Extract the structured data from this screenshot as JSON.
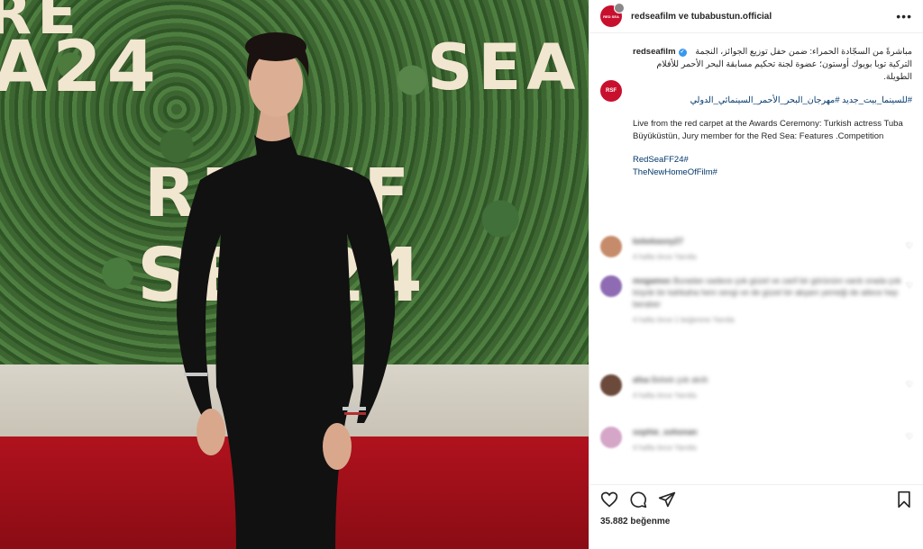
{
  "photo": {
    "backdrop_logo_top": "RE",
    "backdrop_logo_top2": "A24",
    "backdrop_logo_mid": "REDFF",
    "backdrop_logo_mid2": "SEA24",
    "backdrop_logo_right": "SEA"
  },
  "header": {
    "title": "redseafilm ve tubabustun.official",
    "avatar_text": "RED SEA"
  },
  "caption": {
    "username": "redseafilm",
    "arabic_text": "مباشرةً من السجّادة الحمراء: ضمن حفل توزيع الجوائز، النجمة التركية توبا بويوك أوستون؛ عضوة لجنة تحكيم مسابقة البحر الأحمر للأفلام الطويلة.",
    "arabic_tags": "#للسينما_بيت_جديد #مهرجان_البحر_الأحمر_السينمائي_الدولي",
    "english_text": "Live from the red carpet at the Awards Ceremony: Turkish actress Tuba Büyüküstün, Jury member for the Red Sea: Features .Competition",
    "tag1": "RedSeaFF24#",
    "tag2": "TheNewHomeOfFilm#"
  },
  "comments": [
    {
      "user": "kebekasoy27",
      "text": "",
      "meta": "4 hafta önce    Yanıtla",
      "avatar_color": "#c68b6a"
    },
    {
      "user": "mogamoc",
      "text": "Buradan sadece çok güzel ve zarif bir görünüm vardı orada çok büyük bir kahkaha hem sevgi ve de güzel bir akşam yemeği de ailece hep beraber",
      "meta": "4 hafta önce    1 beğenme    Yanıtla",
      "avatar_color": "#8e6bb3"
    },
    {
      "user": "afsa",
      "text": "Bebek çok akıllı",
      "meta": "4 hafta önce    Yanıtla",
      "avatar_color": "#6b4a3c"
    },
    {
      "user": "sophie_sohonan",
      "text": "",
      "meta": "4 hafta önce    Yanıtla",
      "avatar_color": "#d6a6c8"
    }
  ],
  "actions": {
    "like_icon": "heart-icon",
    "comment_icon": "comment-icon",
    "share_icon": "send-icon",
    "save_icon": "bookmark-icon"
  },
  "likes": "35.882 beğenme"
}
